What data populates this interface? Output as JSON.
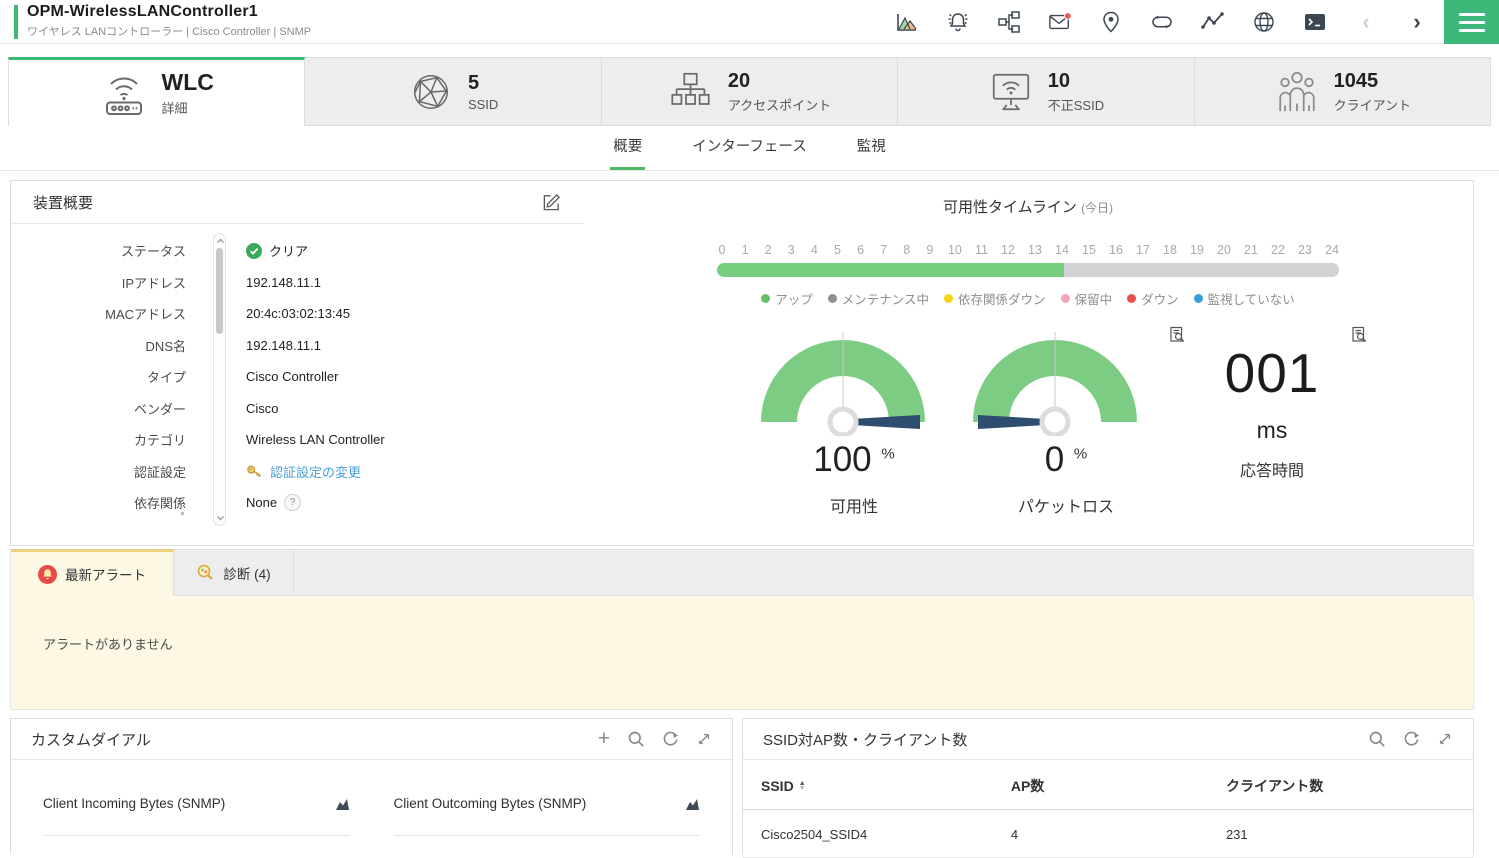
{
  "header": {
    "title": "OPM-WirelessLANController1",
    "subtitle": "ワイヤレス LANコントローラー | Cisco Controller | SNMP"
  },
  "colors": {
    "accent_green": "#3cb878",
    "timeline_green": "#76ce7e",
    "timeline_gray": "#d2d2d4",
    "gauge_green": "#7ccd83",
    "needle_navy": "#2f4d6e",
    "alert_bg": "#fcf8e3",
    "alert_tab_border": "#ecd27c",
    "link_blue": "#4a9fd8",
    "mail_badge_red": "#f25454",
    "alert_badge_red": "#e84a4a"
  },
  "summary_tabs": [
    {
      "value": "WLC",
      "label": "詳細"
    },
    {
      "value": "5",
      "label": "SSID"
    },
    {
      "value": "20",
      "label": "アクセスポイント"
    },
    {
      "value": "10",
      "label": "不正SSID"
    },
    {
      "value": "1045",
      "label": "クライアント"
    }
  ],
  "nav_tabs": [
    {
      "label": "概要"
    },
    {
      "label": "インターフェース"
    },
    {
      "label": "監視"
    }
  ],
  "device_summary": {
    "title": "装置概要",
    "fields": [
      {
        "label": "ステータス",
        "value": "クリア"
      },
      {
        "label": "IPアドレス",
        "value": "192.148.11.1"
      },
      {
        "label": "MACアドレス",
        "value": "20:4c:03:02:13:45"
      },
      {
        "label": "DNS名",
        "value": "192.148.11.1"
      },
      {
        "label": "タイプ",
        "value": "Cisco Controller"
      },
      {
        "label": "ベンダー",
        "value": "Cisco"
      },
      {
        "label": "カテゴリ",
        "value": "Wireless LAN Controller"
      },
      {
        "label": "認証設定",
        "value": "認証設定の変更"
      },
      {
        "label": "依存関係",
        "value": "None"
      }
    ]
  },
  "availability": {
    "title": "可用性タイムライン",
    "suffix": "(今日)",
    "ticks": [
      "0",
      "1",
      "2",
      "3",
      "4",
      "5",
      "6",
      "7",
      "8",
      "9",
      "10",
      "11",
      "12",
      "13",
      "14",
      "15",
      "16",
      "17",
      "18",
      "19",
      "20",
      "21",
      "22",
      "23",
      "24"
    ],
    "up_width": "55.8%",
    "legend": [
      {
        "label": "アップ",
        "color": "#6abf69"
      },
      {
        "label": "メンテナンス中",
        "color": "#8f8f8f"
      },
      {
        "label": "依存関係ダウン",
        "color": "#f2d411"
      },
      {
        "label": "保留中",
        "color": "#f3a6b6"
      },
      {
        "label": "ダウン",
        "color": "#e8504f"
      },
      {
        "label": "監視していない",
        "color": "#3b9bd8"
      }
    ],
    "gauges": [
      {
        "value": "100",
        "unit": "%",
        "label": "可用性"
      },
      {
        "value": "0",
        "unit": "%",
        "label": "パケットロス"
      }
    ],
    "response": {
      "value": "001",
      "unit": "ms",
      "label": "応答時間"
    }
  },
  "alerts": {
    "tabs": [
      {
        "label": "最新アラート"
      },
      {
        "label": "診断",
        "count": "(4)"
      }
    ],
    "empty_message": "アラートがありません"
  },
  "custom_dials": {
    "title": "カスタムダイアル",
    "items": [
      {
        "label": "Client Incoming Bytes (SNMP)"
      },
      {
        "label": "Client Outcoming Bytes (SNMP)"
      }
    ]
  },
  "ssid_table": {
    "title": "SSID対AP数・クライアント数",
    "columns": [
      "SSID",
      "AP数",
      "クライアント数"
    ],
    "rows": [
      [
        "Cisco2504_SSID4",
        "4",
        "231"
      ]
    ]
  },
  "icons": {
    "plus": "+",
    "chevron_left": "‹",
    "chevron_right": "›",
    "help": "?",
    "sort_asc": "▲",
    "sort_desc": "▼"
  }
}
